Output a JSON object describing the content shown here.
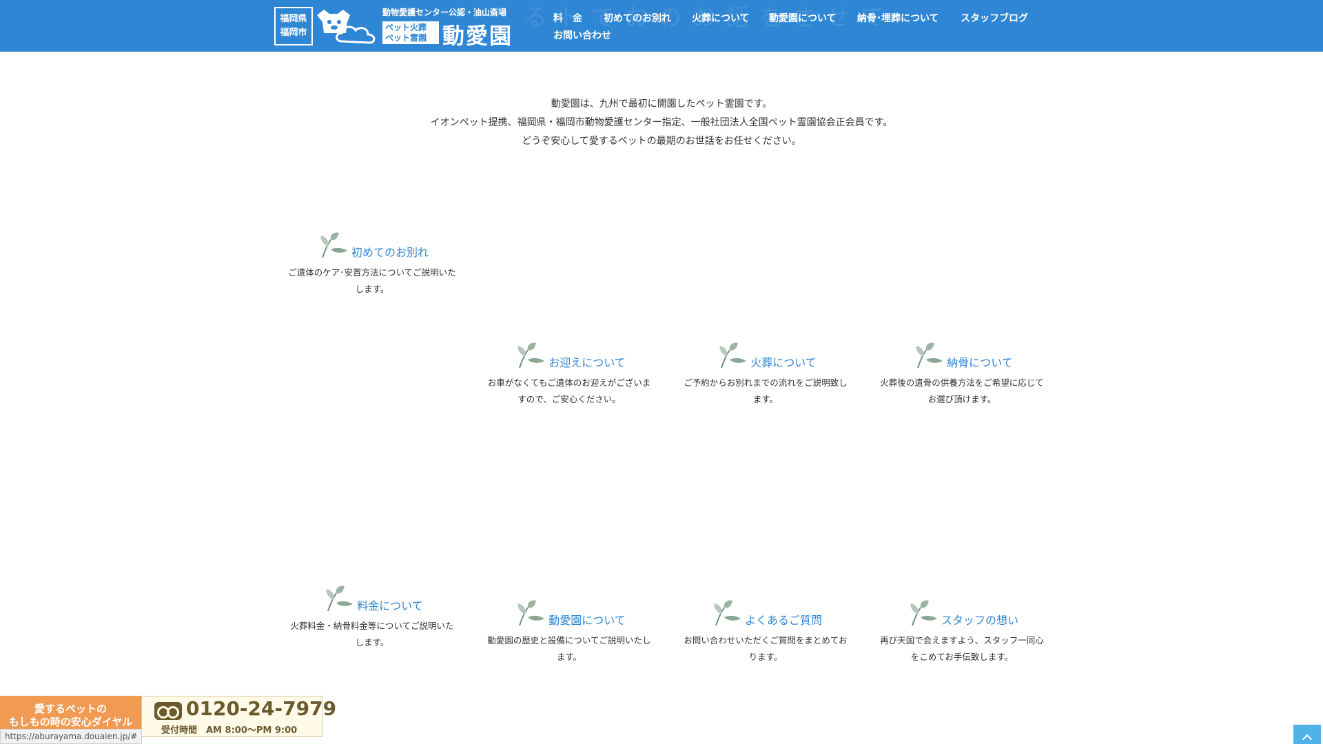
{
  "header": {
    "ghost_text": "る    ト    で    お    の    お    話    を    さ    せ    て",
    "logo_box": [
      "福岡県",
      "福岡市"
    ],
    "logo_caption": "動物愛護センター公認・油山斎場",
    "logo_badge": [
      "ペット火葬",
      "ペット霊園"
    ],
    "logo_name": "動愛園"
  },
  "nav": [
    "料　金",
    "初めてのお別れ",
    "火葬について",
    "動愛園について",
    "納骨･埋葬について",
    "スタッフブログ",
    "お問い合わせ"
  ],
  "intro": [
    "動愛園は、九州で最初に開園したペット霊園です。",
    "イオンペット提携、福岡県・福岡市動物愛護センター指定、一般社団法人全国ペット霊園協会正会員です。",
    "どうぞ安心して愛するペットの最期のお世話をお任せください。"
  ],
  "cards": [
    {
      "title": "初めてのお別れ",
      "desc": "ご遺体のケア･安置方法についてご説明いたします。"
    },
    {
      "title": "お迎えについて",
      "desc": "お車がなくてもご遺体のお迎えがございますので、ご安心ください。"
    },
    {
      "title": "火葬について",
      "desc": "ご予約からお別れまでの流れをご説明致します。"
    },
    {
      "title": "納骨について",
      "desc": "火葬後の遺骨の供養方法をご希望に応じてお選び頂けます。"
    },
    {
      "title": "料金について",
      "desc": "火葬料金・納骨料金等についてご説明いたします。"
    },
    {
      "title": "動愛園について",
      "desc": "動愛園の歴史と設備についてご説明いたします。"
    },
    {
      "title": "よくあるご質問",
      "desc": "お問い合わせいただくご質問をまとめております。"
    },
    {
      "title": "スタッフの想い",
      "desc": "再び天国で会えますよう、スタッフ一同心をこめてお手伝致します。"
    }
  ],
  "phone": {
    "tagline": [
      "愛するペットの",
      "もしもの時の安心ダイヤル"
    ],
    "number": "0120-24-7979",
    "hours": "受付時間　AM 8:00〜PM 9:00"
  },
  "status_url": "https://aburayama.douaien.jp/#",
  "colors": {
    "header": "#2f86d4",
    "title": "#2f86d4",
    "banner_orange": "#f19a52",
    "banner_text": "#6b5a2e"
  }
}
